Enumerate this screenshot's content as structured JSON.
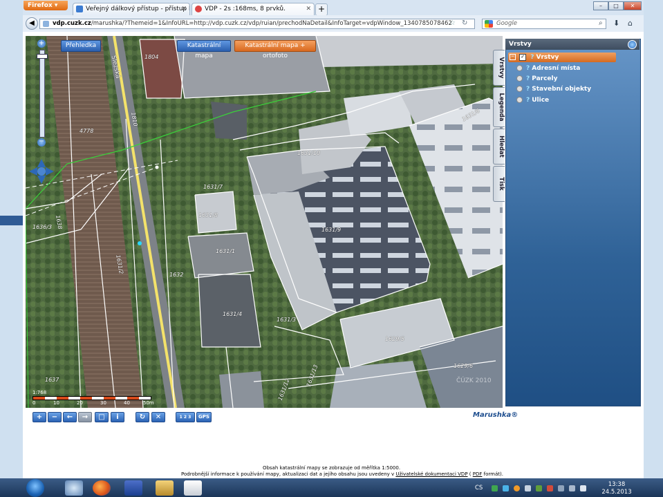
{
  "browser": {
    "app_button": "Firefox",
    "tabs": [
      {
        "title": "Veřejný dálkový přístup - přístup k da...",
        "active": false
      },
      {
        "title": "VDP - 2s :168ms, 8 prvků.",
        "active": true
      }
    ],
    "new_tab_glyph": "+",
    "url_host": "vdp.cuzk.cz",
    "url_rest": "/marushka/?Themeid=1&InfoURL=http://vdp.cuzk.cz/vdp/ruian/prechodNaDetail&InfoTarget=vdpWindow_1340785078462",
    "search_placeholder": "Google",
    "window_buttons": [
      "–",
      "□",
      "✕"
    ]
  },
  "map": {
    "buttons": {
      "overview": "Přehledka",
      "cadastral": "Katastrální mapa",
      "cadastral_ortho": "Katastrální mapa + ortofoto"
    },
    "parcel_labels": [
      {
        "text": "1804"
      },
      {
        "text": "4778"
      },
      {
        "text": "1810"
      },
      {
        "text": "1631/10"
      },
      {
        "text": "1631/7"
      },
      {
        "text": "1631/8"
      },
      {
        "text": "1631/9"
      },
      {
        "text": "1631/1"
      },
      {
        "text": "1632"
      },
      {
        "text": "1631/4"
      },
      {
        "text": "1631/3"
      },
      {
        "text": "1629/5"
      },
      {
        "text": "1631/2"
      },
      {
        "text": "1629/6"
      },
      {
        "text": "1637"
      },
      {
        "text": "1636/3"
      },
      {
        "text": "1631/12"
      },
      {
        "text": "1631/13"
      },
      {
        "text": "1638"
      },
      {
        "text": "1631/6"
      }
    ],
    "street_label": "Slezská",
    "watermark": "ČÚZK 2010",
    "scale": {
      "ratio": "1:768",
      "ticks": [
        "0",
        "10",
        "20",
        "30",
        "40",
        "50m"
      ]
    }
  },
  "layers_panel": {
    "header": "Vrstvy",
    "side_tabs": [
      "Vrstvy",
      "Legenda",
      "Hledat",
      "Tisk"
    ],
    "items": [
      {
        "label": "Vrstvy",
        "checked": true,
        "root": true
      },
      {
        "label": "Adresní místa"
      },
      {
        "label": "Parcely"
      },
      {
        "label": "Stavební objekty"
      },
      {
        "label": "Ulice"
      }
    ]
  },
  "toolbar": {
    "buttons": [
      "+",
      "−",
      "←",
      "→",
      "□",
      "i",
      "↻",
      "✕"
    ],
    "label_123": "1 2 3",
    "gps": "GPS"
  },
  "brand": "Marushka®",
  "footer": {
    "line1": "Obsah katastrální mapy se zobrazuje od měřítka 1:5000.",
    "line2_pre": "Podrobnější informace k používání mapy, aktualizaci dat a jejího obsahu jsou uvedeny v",
    "link_doc": "Uživatelské dokumentaci VDP",
    "paren_open": "(",
    "link_pdf": "PDF",
    "paren_close": "formát)."
  },
  "taskbar": {
    "lang": "CS",
    "time": "13:38",
    "date": "24.5.2013"
  },
  "colors": {
    "accent": "#2c63b4",
    "panel": "#2f6297",
    "orange_btn": "#e8893a"
  }
}
